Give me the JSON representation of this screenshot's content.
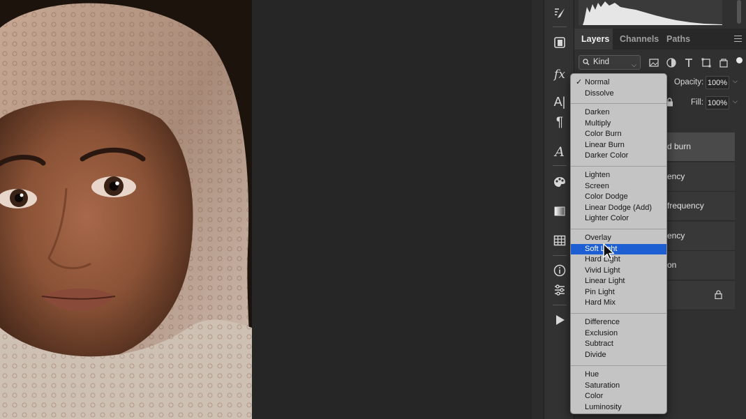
{
  "tabs": [
    {
      "label": "Layers",
      "active": true
    },
    {
      "label": "Channels",
      "active": false
    },
    {
      "label": "Paths",
      "active": false
    }
  ],
  "filter": {
    "kind_label": "Kind"
  },
  "opacity": {
    "label": "Opacity:",
    "value": "100%"
  },
  "fill": {
    "label": "Fill:",
    "value": "100%"
  },
  "layers": [
    {
      "visible_text": "d burn",
      "selected": true
    },
    {
      "visible_text": "ency",
      "selected": false
    },
    {
      "visible_text": "frequency",
      "selected": false
    },
    {
      "visible_text": "ency",
      "selected": false
    },
    {
      "visible_text": "on",
      "selected": false
    }
  ],
  "blend_menu": {
    "checked": "Normal",
    "highlighted": "Soft Light",
    "groups": [
      [
        "Normal",
        "Dissolve"
      ],
      [
        "Darken",
        "Multiply",
        "Color Burn",
        "Linear Burn",
        "Darker Color"
      ],
      [
        "Lighten",
        "Screen",
        "Color Dodge",
        "Linear Dodge (Add)",
        "Lighter Color"
      ],
      [
        "Overlay",
        "Soft Light",
        "Hard Light",
        "Vivid Light",
        "Linear Light",
        "Pin Light",
        "Hard Mix"
      ],
      [
        "Difference",
        "Exclusion",
        "Subtract",
        "Divide"
      ],
      [
        "Hue",
        "Saturation",
        "Color",
        "Luminosity"
      ]
    ]
  },
  "colors": {
    "accent": "#1d5fd2",
    "panel": "#303030",
    "menu_bg": "#c4c4c4"
  }
}
